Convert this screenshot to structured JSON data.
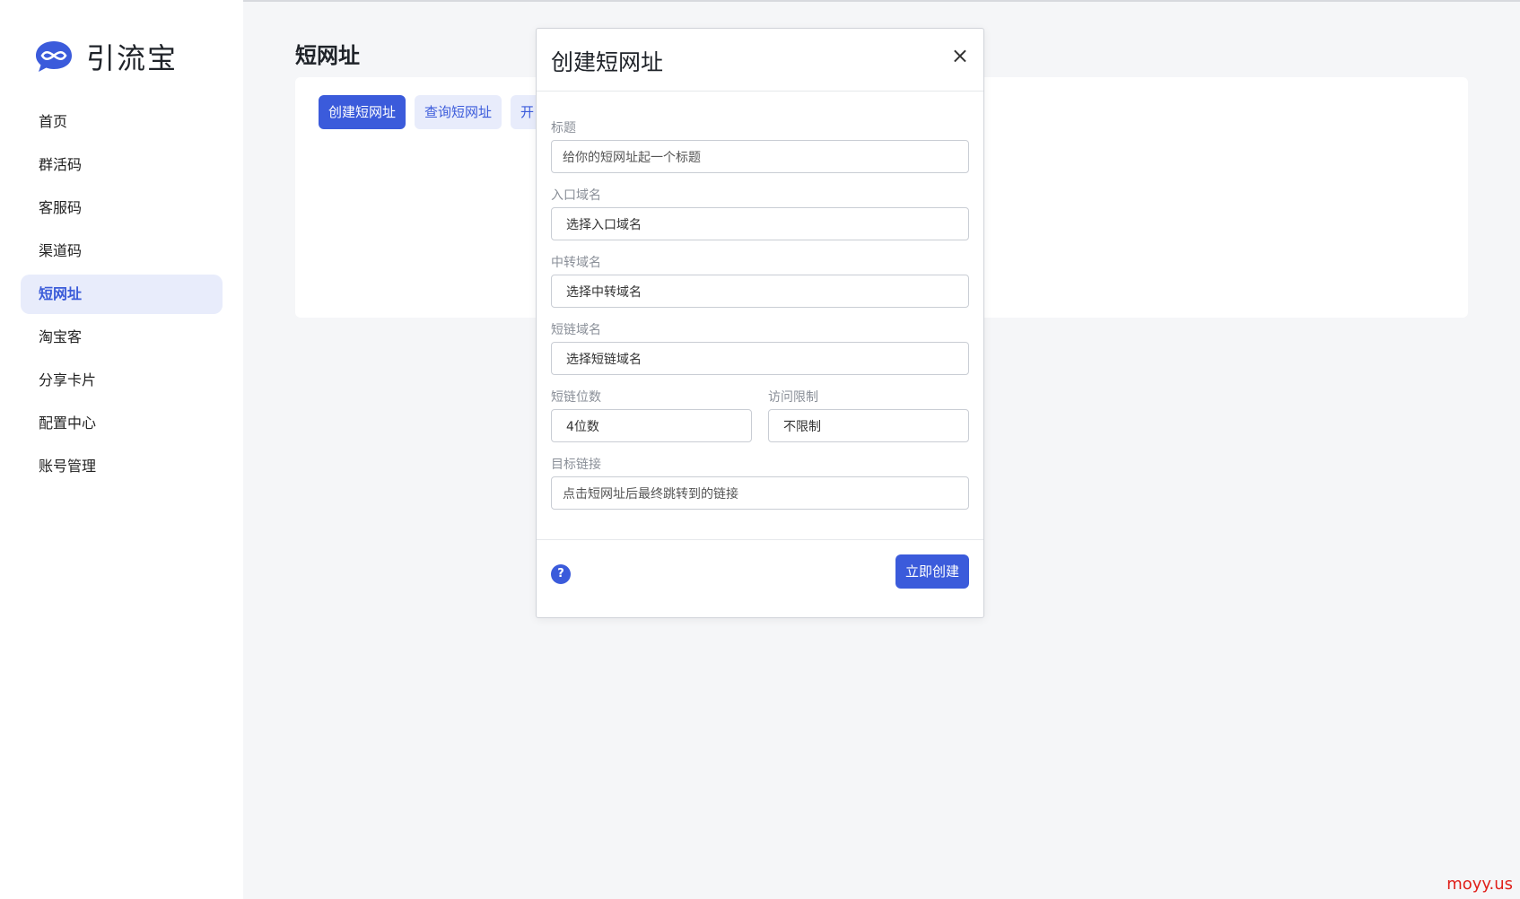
{
  "app": {
    "name": "引流宝"
  },
  "sidebar": {
    "items": [
      {
        "label": "首页",
        "active": false
      },
      {
        "label": "群活码",
        "active": false
      },
      {
        "label": "客服码",
        "active": false
      },
      {
        "label": "渠道码",
        "active": false
      },
      {
        "label": "短网址",
        "active": true
      },
      {
        "label": "淘宝客",
        "active": false
      },
      {
        "label": "分享卡片",
        "active": false
      },
      {
        "label": "配置中心",
        "active": false
      },
      {
        "label": "账号管理",
        "active": false
      }
    ]
  },
  "main": {
    "title": "短网址",
    "buttons": {
      "create": "创建短网址",
      "query": "查询短网址",
      "open": "开"
    }
  },
  "modal": {
    "title": "创建短网址",
    "close": "×",
    "fields": {
      "title": {
        "label": "标题",
        "placeholder": "给你的短网址起一个标题"
      },
      "entry_domain": {
        "label": "入口域名",
        "value": "选择入口域名"
      },
      "relay_domain": {
        "label": "中转域名",
        "value": "选择中转域名"
      },
      "short_domain": {
        "label": "短链域名",
        "value": "选择短链域名"
      },
      "digits": {
        "label": "短链位数",
        "value": "4位数"
      },
      "access_limit": {
        "label": "访问限制",
        "value": "不限制"
      },
      "target_link": {
        "label": "目标链接",
        "placeholder": "点击短网址后最终跳转到的链接"
      }
    },
    "help": "?",
    "submit": "立即创建"
  },
  "watermark": "moyy.us",
  "colors": {
    "primary": "#3b5bdb",
    "active_bg": "#e8ecfb",
    "watermark": "#e0201a"
  }
}
